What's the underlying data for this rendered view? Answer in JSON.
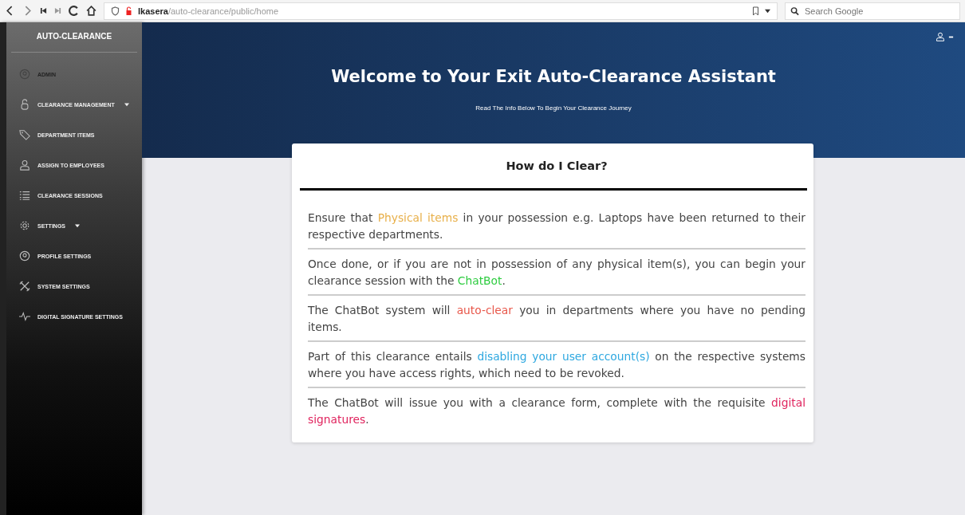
{
  "browser": {
    "url_host": "lkasera",
    "url_path": "/auto-clearance/public/home",
    "search": {
      "placeholder": "Search Google"
    }
  },
  "sidebar": {
    "brand": "AUTO-CLEARANCE",
    "items": [
      {
        "label": "ADMIN",
        "kind": "user",
        "caret": false
      },
      {
        "label": "CLEARANCE MANAGEMENT",
        "kind": "link",
        "caret": true
      },
      {
        "label": "DEPARTMENT ITEMS",
        "kind": "link",
        "caret": false
      },
      {
        "label": "ASSIGN TO EMPLOYEES",
        "kind": "link",
        "caret": false
      },
      {
        "label": "CLEARANCE SESSIONS",
        "kind": "link",
        "caret": false
      },
      {
        "label": "SETTINGS",
        "kind": "link",
        "caret": true
      },
      {
        "label": "PROFILE SETTINGS",
        "kind": "link",
        "caret": false
      },
      {
        "label": "SYSTEM SETTINGS",
        "kind": "link",
        "caret": false
      },
      {
        "label": "DIGITAL SIGNATURE SETTINGS",
        "kind": "link",
        "caret": false
      }
    ]
  },
  "header": {
    "title": "Welcome to Your Exit Auto-Clearance Assistant",
    "subtitle": "Read The Info Below To Begin Your Clearance Journey"
  },
  "card": {
    "title": "How do I Clear?",
    "paragraphs": [
      [
        {
          "text": "Ensure that "
        },
        {
          "text": "Physical items",
          "color": "#e8b04a"
        },
        {
          "text": " in your possession e.g. Laptops have been returned to their respective departments."
        }
      ],
      [
        {
          "text": "Once done, or if you are not in possession of any physical item(s), you can begin your clearance session with the "
        },
        {
          "text": "ChatBot",
          "color": "#2ecc40"
        },
        {
          "text": "."
        }
      ],
      [
        {
          "text": "The ChatBot system will "
        },
        {
          "text": "auto-clear",
          "color": "#e8574a"
        },
        {
          "text": " you in departments where you have no pending items."
        }
      ],
      [
        {
          "text": "Part of this clearance entails "
        },
        {
          "text": "disabling your user account(s)",
          "color": "#2ea8e0"
        },
        {
          "text": " on the respective systems where you have access rights, which need to be revoked."
        }
      ],
      [
        {
          "text": "The ChatBot will issue you with a clearance form, complete with the requisite "
        },
        {
          "text": "digital signatures",
          "color": "#e0245e"
        },
        {
          "text": "."
        }
      ]
    ]
  }
}
